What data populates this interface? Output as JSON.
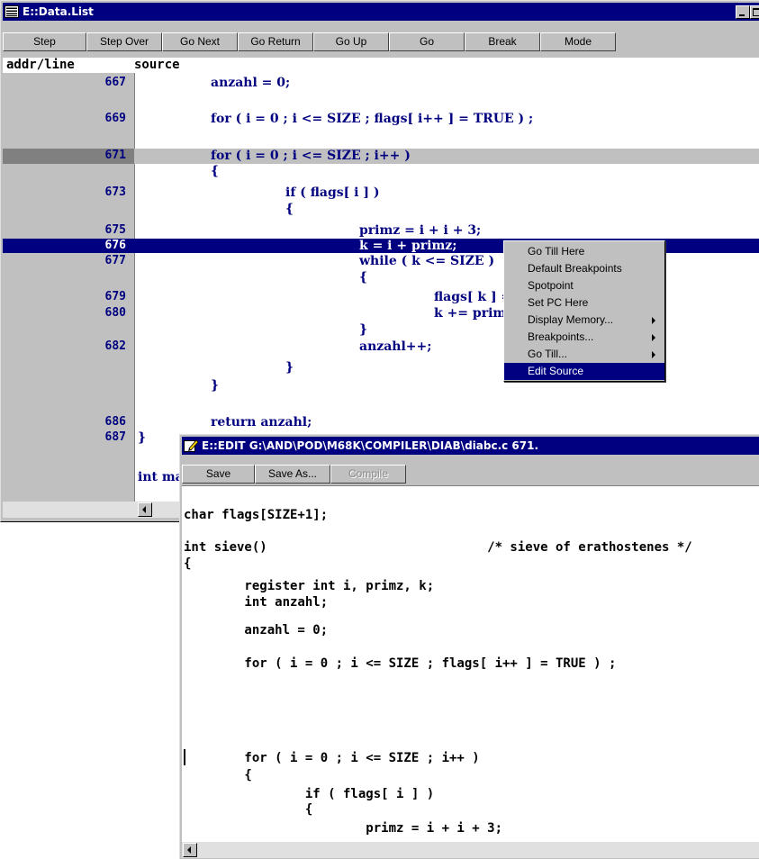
{
  "data_list": {
    "title": "E::Data.List",
    "toolbar": [
      "Step",
      "Step Over",
      "Go Next",
      "Go Return",
      "Go Up",
      "Go",
      "Break",
      "Mode"
    ],
    "columns": {
      "addr": "addr/line",
      "source": "source"
    },
    "rows": [
      {
        "ln": "667",
        "src": "anzahl = 0;"
      },
      {
        "ln": "669",
        "src": "for ( i = 0 ; i <= SIZE ; flags[ i++ ] = TRUE ) ;"
      },
      {
        "ln": "671",
        "src": "for ( i = 0 ; i <= SIZE ; i++ )"
      },
      {
        "ln": "",
        "src": "{"
      },
      {
        "ln": "673",
        "src": "if ( flags[ i ] )"
      },
      {
        "ln": "",
        "src": "{"
      },
      {
        "ln": "675",
        "src": "primz = i + i + 3;"
      },
      {
        "ln": "676",
        "src": "k = i + primz;"
      },
      {
        "ln": "677",
        "src": "while ( k <= SIZE )"
      },
      {
        "ln": "",
        "src": "{"
      },
      {
        "ln": "679",
        "src": "flags[ k ] = FALSE;"
      },
      {
        "ln": "680",
        "src": "k += primz;"
      },
      {
        "ln": "",
        "src": "}"
      },
      {
        "ln": "682",
        "src": "anzahl++;"
      },
      {
        "ln": "",
        "src": "}"
      },
      {
        "ln": "",
        "src": "}"
      },
      {
        "ln": "686",
        "src": "return anzahl;"
      },
      {
        "ln": "687",
        "src": "}"
      },
      {
        "ln": "",
        "src": "int main()"
      }
    ]
  },
  "context_menu": {
    "items": [
      {
        "label": "Go Till Here",
        "submenu": false
      },
      {
        "label": "Default Breakpoints",
        "submenu": false
      },
      {
        "label": "Spotpoint",
        "submenu": false
      },
      {
        "label": "Set PC Here",
        "submenu": false
      },
      {
        "label": "Display Memory...",
        "submenu": true
      },
      {
        "label": "Breakpoints...",
        "submenu": true
      },
      {
        "label": "Go Till...",
        "submenu": true
      },
      {
        "label": "Edit Source",
        "submenu": false
      }
    ]
  },
  "editor": {
    "title": "E::EDIT G:\\AND\\POD\\M68K\\COMPILER\\DIAB\\diabc.c 671.",
    "toolbar": [
      {
        "label": "Save",
        "enabled": true
      },
      {
        "label": "Save As...",
        "enabled": true
      },
      {
        "label": "Compile",
        "enabled": false
      }
    ],
    "lines": [
      "char flags[SIZE+1];",
      "",
      "int sieve()                             /* sieve of erathostenes */",
      "{",
      "        register int i, primz, k;",
      "        int anzahl;",
      "",
      "        anzahl = 0;",
      "",
      "        for ( i = 0 ; i <= SIZE ; flags[ i++ ] = TRUE ) ;",
      "",
      "",
      "",
      "        for ( i = 0 ; i <= SIZE ; i++ )",
      "        {",
      "                if ( flags[ i ] )",
      "                {",
      "                        primz = i + i + 3;"
    ]
  },
  "colors": {
    "title_active": "#000080",
    "selection": "#000080",
    "current_line": "#c0c0c0",
    "marker_gutter": "#808080"
  }
}
